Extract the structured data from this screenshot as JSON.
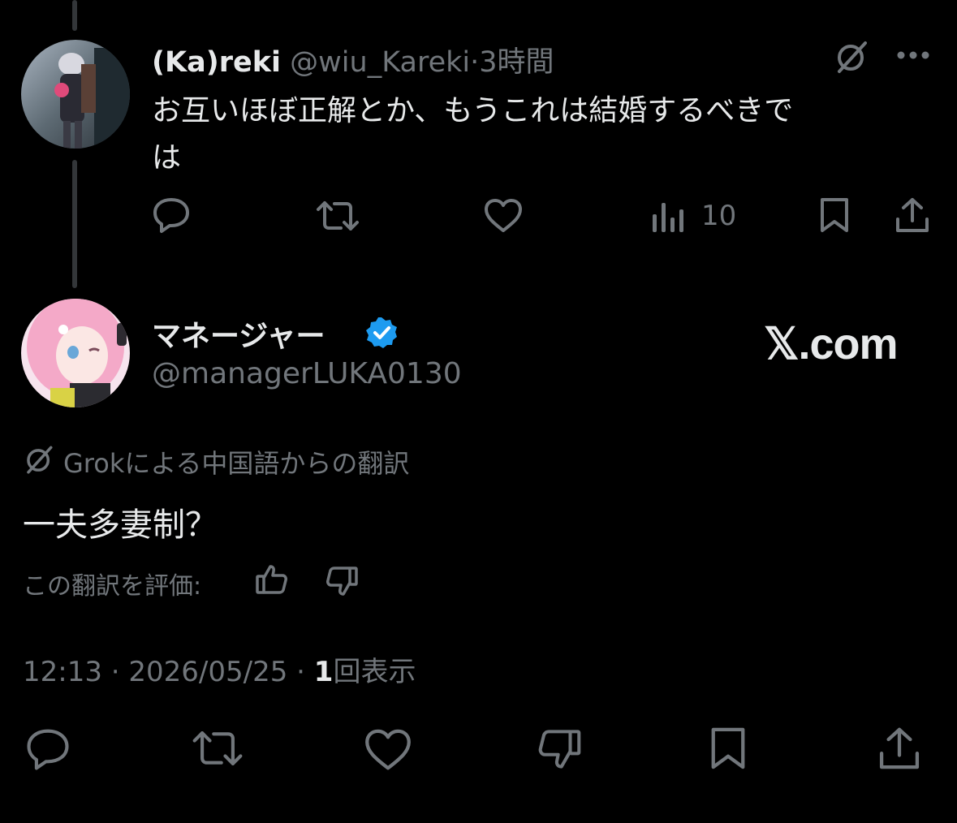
{
  "reply_tweet": {
    "display_name": "(Ka)reki",
    "handle": "@wiu_Kareki",
    "separator": "·",
    "time_ago": "3時間",
    "text_line1": "お互いほぼ正解とか、もうこれは結婚するべきで",
    "text_line2": "は",
    "views": "10"
  },
  "main_tweet": {
    "display_name": "マネージャー",
    "handle": "@managerLUKA0130",
    "watermark": "𝕏.com",
    "translation_label": "Grokによる中国語からの翻訳",
    "text": "一夫多妻制？",
    "rate_label": "この翻訳を評価:",
    "meta_time": "12:13 · 2026/05/25 · ",
    "meta_views_count": "1",
    "meta_views_label": "回表示"
  },
  "colors": {
    "background": "#000000",
    "text_primary": "#e7e9ea",
    "text_secondary": "#71767b",
    "verified_blue": "#1d9bf0"
  }
}
